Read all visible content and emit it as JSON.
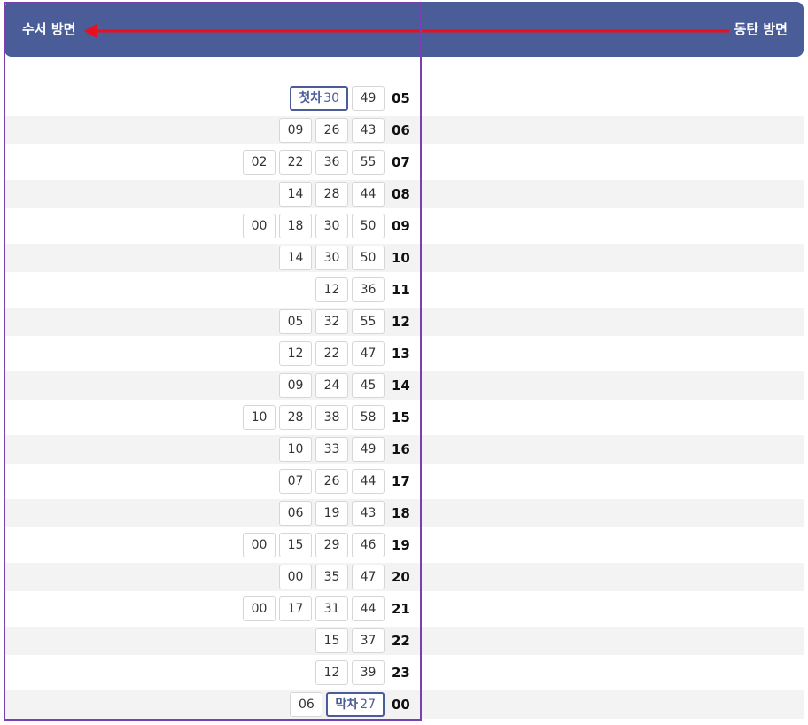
{
  "header": {
    "left_label": "수서 방면",
    "right_label": "동탄 방면",
    "bg_color": "#4b5d98",
    "arrow_color": "#e8101e"
  },
  "highlight_color": "#7a3fb0",
  "timetable": [
    {
      "hour": "05",
      "minutes": [
        {
          "tag": "첫차",
          "value": "30"
        },
        {
          "value": "49"
        }
      ]
    },
    {
      "hour": "06",
      "minutes": [
        {
          "value": "09"
        },
        {
          "value": "26"
        },
        {
          "value": "43"
        }
      ]
    },
    {
      "hour": "07",
      "minutes": [
        {
          "value": "02"
        },
        {
          "value": "22"
        },
        {
          "value": "36"
        },
        {
          "value": "55"
        }
      ]
    },
    {
      "hour": "08",
      "minutes": [
        {
          "value": "14"
        },
        {
          "value": "28"
        },
        {
          "value": "44"
        }
      ]
    },
    {
      "hour": "09",
      "minutes": [
        {
          "value": "00"
        },
        {
          "value": "18"
        },
        {
          "value": "30"
        },
        {
          "value": "50"
        }
      ]
    },
    {
      "hour": "10",
      "minutes": [
        {
          "value": "14"
        },
        {
          "value": "30"
        },
        {
          "value": "50"
        }
      ]
    },
    {
      "hour": "11",
      "minutes": [
        {
          "value": "12"
        },
        {
          "value": "36"
        }
      ]
    },
    {
      "hour": "12",
      "minutes": [
        {
          "value": "05"
        },
        {
          "value": "32"
        },
        {
          "value": "55"
        }
      ]
    },
    {
      "hour": "13",
      "minutes": [
        {
          "value": "12"
        },
        {
          "value": "22"
        },
        {
          "value": "47"
        }
      ]
    },
    {
      "hour": "14",
      "minutes": [
        {
          "value": "09"
        },
        {
          "value": "24"
        },
        {
          "value": "45"
        }
      ]
    },
    {
      "hour": "15",
      "minutes": [
        {
          "value": "10"
        },
        {
          "value": "28"
        },
        {
          "value": "38"
        },
        {
          "value": "58"
        }
      ]
    },
    {
      "hour": "16",
      "minutes": [
        {
          "value": "10"
        },
        {
          "value": "33"
        },
        {
          "value": "49"
        }
      ]
    },
    {
      "hour": "17",
      "minutes": [
        {
          "value": "07"
        },
        {
          "value": "26"
        },
        {
          "value": "44"
        }
      ]
    },
    {
      "hour": "18",
      "minutes": [
        {
          "value": "06"
        },
        {
          "value": "19"
        },
        {
          "value": "43"
        }
      ]
    },
    {
      "hour": "19",
      "minutes": [
        {
          "value": "00"
        },
        {
          "value": "15"
        },
        {
          "value": "29"
        },
        {
          "value": "46"
        }
      ]
    },
    {
      "hour": "20",
      "minutes": [
        {
          "value": "00"
        },
        {
          "value": "35"
        },
        {
          "value": "47"
        }
      ]
    },
    {
      "hour": "21",
      "minutes": [
        {
          "value": "00"
        },
        {
          "value": "17"
        },
        {
          "value": "31"
        },
        {
          "value": "44"
        }
      ]
    },
    {
      "hour": "22",
      "minutes": [
        {
          "value": "15"
        },
        {
          "value": "37"
        }
      ]
    },
    {
      "hour": "23",
      "minutes": [
        {
          "value": "12"
        },
        {
          "value": "39"
        }
      ]
    },
    {
      "hour": "00",
      "minutes": [
        {
          "value": "06"
        },
        {
          "tag": "막차",
          "value": "27"
        }
      ]
    }
  ]
}
